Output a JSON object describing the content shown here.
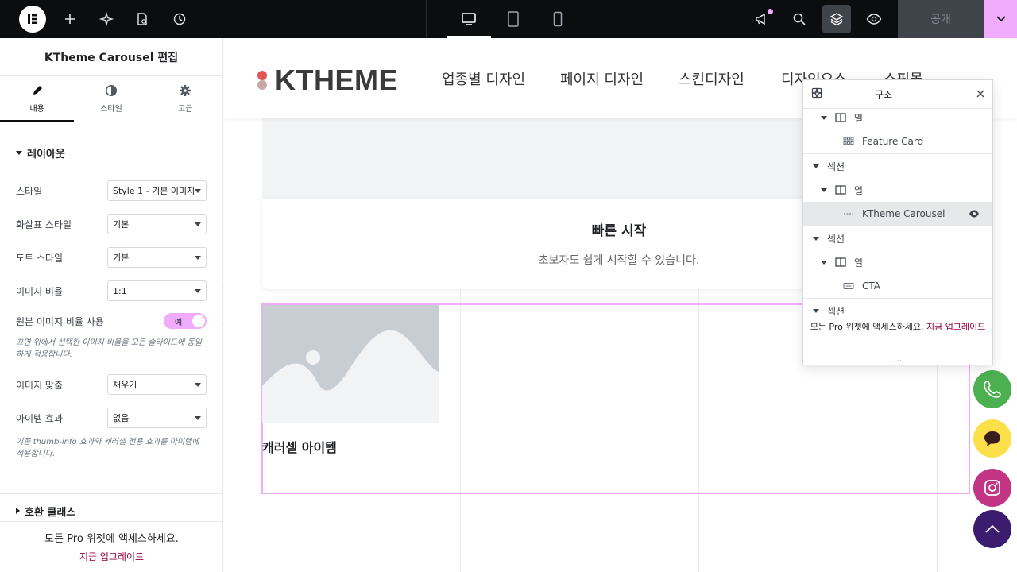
{
  "topbar": {
    "publish_label": "공개"
  },
  "panel": {
    "title": "KTheme Carousel 편집",
    "tabs": [
      {
        "label": "내용",
        "icon": "pencil-icon"
      },
      {
        "label": "스타일",
        "icon": "half-circle-icon"
      },
      {
        "label": "고급",
        "icon": "gear-icon"
      }
    ],
    "section_layout": "레이아웃",
    "controls": {
      "style": {
        "label": "스타일",
        "value": "Style 1 - 기본 이미지"
      },
      "arrow_style": {
        "label": "화살표 스타일",
        "value": "기본"
      },
      "dot_style": {
        "label": "도트 스타일",
        "value": "기본"
      },
      "image_ratio": {
        "label": "이미지 비율",
        "value": "1:1"
      },
      "use_original_ratio": {
        "label": "원본 이미지 비율 사용",
        "value": "예"
      },
      "use_original_ratio_desc": "끄면 위에서 선택한 이미지 비율을 모든 슬라이드에 동일하게 적용합니다.",
      "image_fit": {
        "label": "이미지 맞춤",
        "value": "채우기"
      },
      "item_effect": {
        "label": "아이템 효과",
        "value": "없음"
      },
      "item_effect_desc": "기존 thumb-info 효과와 캐러셀 전용 효과를 아이템에 적용합니다."
    },
    "section_compat": "호환 클래스",
    "promo_text": "모든 Pro 위젯에 액세스하세요.",
    "promo_link": "지금 업그레이드"
  },
  "site": {
    "logo_text": "KTHEME",
    "nav": [
      "업종별 디자인",
      "페이지 디자인",
      "스킨디자인",
      "디자인요소",
      "쇼핑몰"
    ],
    "card_title": "빠른 시작",
    "card_desc": "초보자도 쉽게 시작할 수 있습니다.",
    "carousel_item_title": "캐러셀 아이템"
  },
  "structure": {
    "title": "구조",
    "rows": [
      {
        "label": "열",
        "type": "column"
      },
      {
        "label": "Feature Card",
        "type": "widget"
      },
      {
        "label": "섹션",
        "type": "section"
      },
      {
        "label": "열",
        "type": "column"
      },
      {
        "label": "KTheme Carousel",
        "type": "widget"
      },
      {
        "label": "섹션",
        "type": "section"
      },
      {
        "label": "열",
        "type": "column"
      },
      {
        "label": "CTA",
        "type": "widget"
      },
      {
        "label": "섹션",
        "type": "section"
      }
    ],
    "promo_text": "모든 Pro 위젯에 액세스하세요.",
    "promo_link": "지금 업그레이드",
    "more": "..."
  },
  "colors": {
    "accent": "#f0abfc",
    "topbar": "#0c0d0e",
    "phone": "#4caf50",
    "chat": "#fbe04a",
    "instagram": "#c13584",
    "scroll_top": "#3b1c6e",
    "link": "#93003f"
  }
}
